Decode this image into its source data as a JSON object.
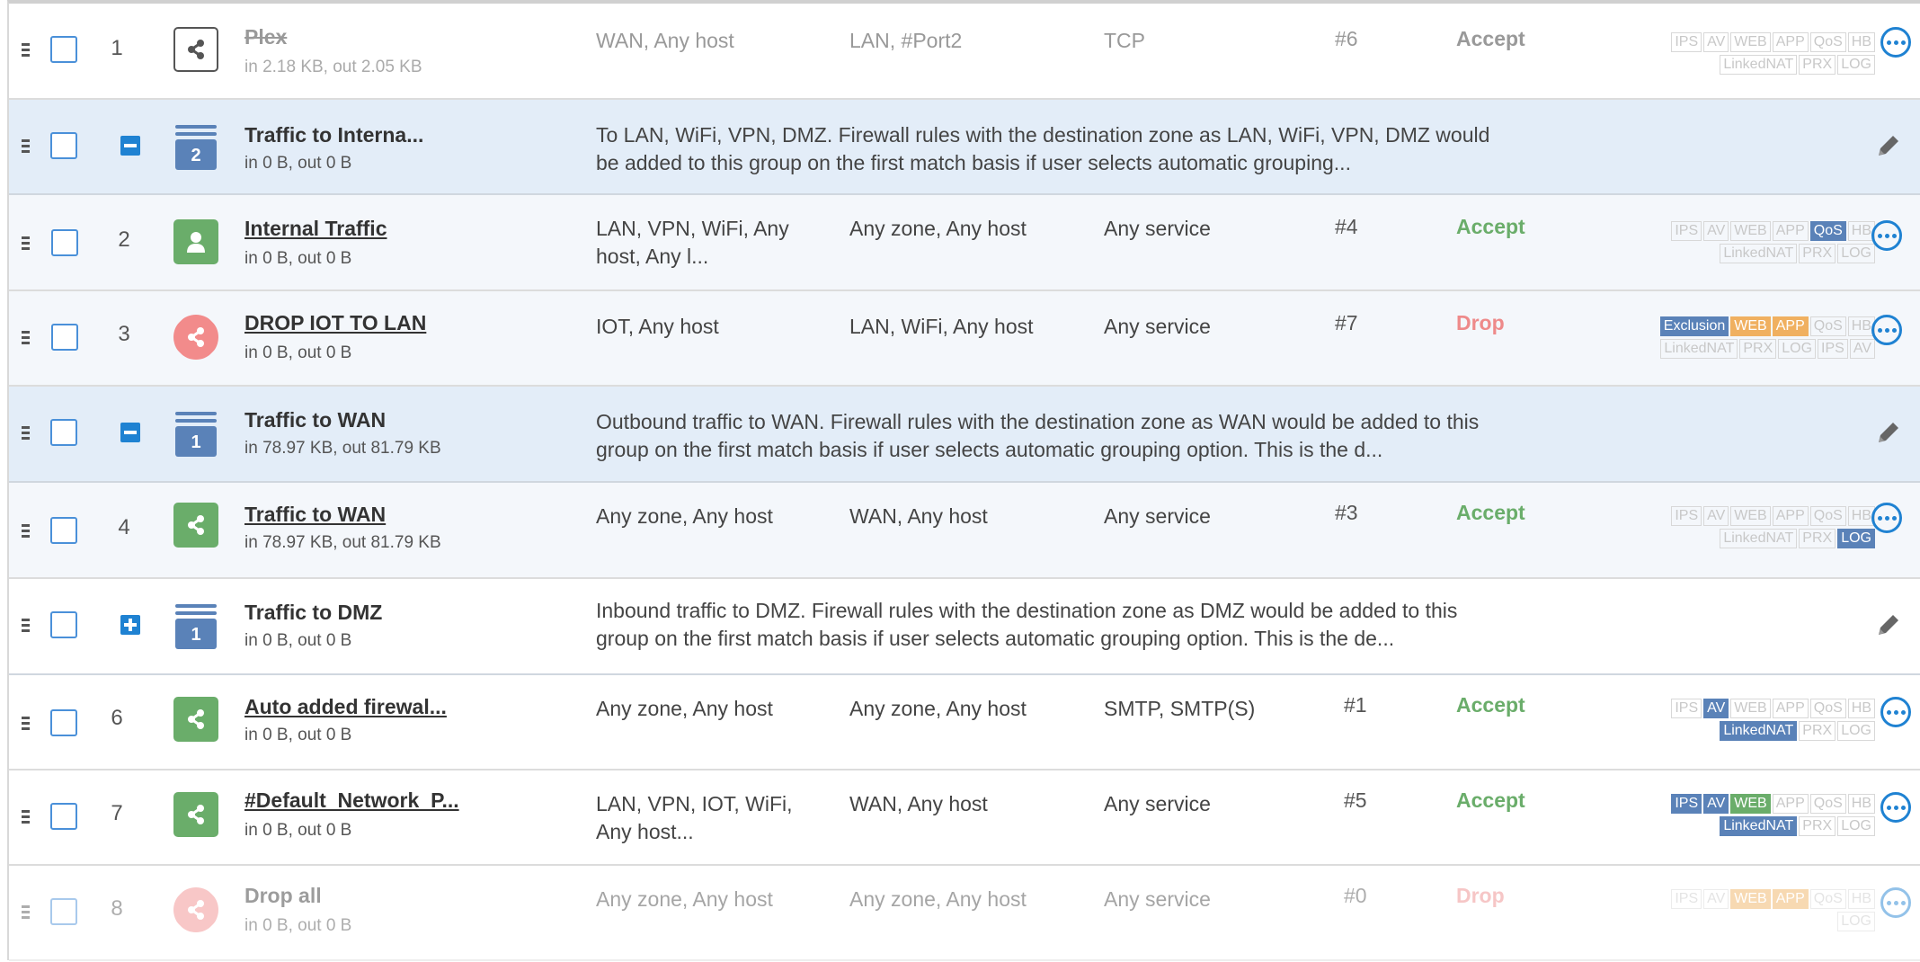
{
  "rows": [
    {
      "kind": "rule",
      "num": "1",
      "name": "Plex",
      "traffic": "in 2.18 KB, out 2.05 KB",
      "source": "WAN, Any host",
      "dest": "LAN, #Port2",
      "service": "TCP",
      "id": "#6",
      "action": "Accept",
      "badges1": [
        "IPS",
        "AV",
        "WEB",
        "APP",
        "QoS",
        "HB"
      ],
      "badges2": [
        "LinkedNAT",
        "PRX",
        "LOG"
      ]
    },
    {
      "kind": "group",
      "name": "Traffic to Interna...",
      "traffic": "in 0 B, out 0 B",
      "count": "2",
      "desc": "To LAN, WiFi, VPN, DMZ. Firewall rules with the destination zone as LAN, WiFi, VPN, DMZ would be added to this group on the first match basis if user selects automatic grouping..."
    },
    {
      "kind": "rule",
      "num": "2",
      "name": "Internal Traffic",
      "traffic": "in 0 B, out 0 B",
      "source": "LAN, VPN, WiFi, Any host, Any l...",
      "dest": "Any zone, Any host",
      "service": "Any service",
      "id": "#4",
      "action": "Accept",
      "badges1": [
        "IPS",
        "AV",
        "WEB",
        "APP",
        "QoS",
        "HB"
      ],
      "badges2": [
        "LinkedNAT",
        "PRX",
        "LOG"
      ]
    },
    {
      "kind": "rule",
      "num": "3",
      "name": "DROP IOT TO LAN",
      "traffic": "in 0 B, out 0 B",
      "source": "IOT, Any host",
      "dest": "LAN, WiFi, Any host",
      "service": "Any service",
      "id": "#7",
      "action": "Drop",
      "badges1": [
        "Exclusion",
        "WEB",
        "APP",
        "QoS",
        "HB"
      ],
      "badges2": [
        "LinkedNAT",
        "PRX",
        "LOG",
        "IPS",
        "AV"
      ]
    },
    {
      "kind": "group",
      "name": "Traffic to WAN",
      "traffic": "in 78.97 KB, out 81.79 KB",
      "count": "1",
      "desc": "Outbound traffic to WAN. Firewall rules with the destination zone as WAN would be added to this group on the first match basis if user selects automatic grouping option. This is the d..."
    },
    {
      "kind": "rule",
      "num": "4",
      "name": "Traffic to WAN",
      "traffic": "in 78.97 KB, out 81.79 KB",
      "source": "Any zone, Any host",
      "dest": "WAN, Any host",
      "service": "Any service",
      "id": "#3",
      "action": "Accept",
      "badges1": [
        "IPS",
        "AV",
        "WEB",
        "APP",
        "QoS",
        "HB"
      ],
      "badges2": [
        "LinkedNAT",
        "PRX",
        "LOG"
      ]
    },
    {
      "kind": "group",
      "name": "Traffic to DMZ",
      "traffic": "in 0 B, out 0 B",
      "count": "1",
      "desc": "Inbound traffic to DMZ. Firewall rules with the destination zone as DMZ would be added to this group on the first match basis if user selects automatic grouping option. This is the de..."
    },
    {
      "kind": "rule",
      "num": "6",
      "name": "Auto added firewal...",
      "traffic": "in 0 B, out 0 B",
      "source": "Any zone, Any host",
      "dest": "Any zone, Any host",
      "service": "SMTP, SMTP(S)",
      "id": "#1",
      "action": "Accept",
      "badges1": [
        "IPS",
        "AV",
        "WEB",
        "APP",
        "QoS",
        "HB"
      ],
      "badges2": [
        "LinkedNAT",
        "PRX",
        "LOG"
      ]
    },
    {
      "kind": "rule",
      "num": "7",
      "name": "#Default_Network_P...",
      "traffic": "in 0 B, out 0 B",
      "source": "LAN, VPN, IOT, WiFi, Any host...",
      "dest": "WAN, Any host",
      "service": "Any service",
      "id": "#5",
      "action": "Accept",
      "badges1": [
        "IPS",
        "AV",
        "WEB",
        "APP",
        "QoS",
        "HB"
      ],
      "badges2": [
        "LinkedNAT",
        "PRX",
        "LOG"
      ]
    },
    {
      "kind": "rule",
      "num": "8",
      "name": "Drop all",
      "traffic": "in 0 B, out 0 B",
      "source": "Any zone, Any host",
      "dest": "Any zone, Any host",
      "service": "Any service",
      "id": "#0",
      "action": "Drop",
      "badges1": [
        "IPS",
        "AV",
        "WEB",
        "APP",
        "QoS",
        "HB"
      ],
      "badges2": [
        "LOG"
      ]
    }
  ]
}
